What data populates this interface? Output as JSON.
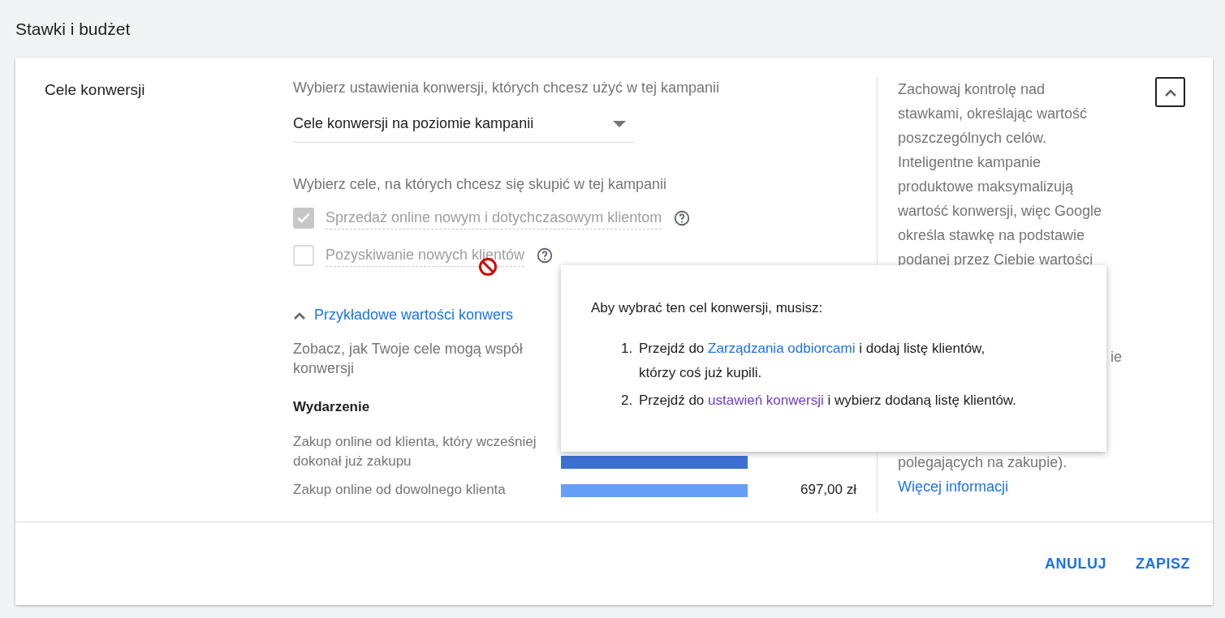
{
  "page_title": "Stawki i budżet",
  "section": {
    "label": "Cele konwersji",
    "settings_label": "Wybierz ustawienia konwersji, których chcesz użyć w tej kampanii",
    "dropdown": {
      "value": "Cele konwersji na poziomie kampanii"
    },
    "goals_label": "Wybierz cele, na których chcesz się skupić w tej kampanii",
    "goals": [
      {
        "label": "Sprzedaż online nowym i dotychczasowym klientom",
        "checked": true,
        "disabled": true
      },
      {
        "label": "Pozyskiwanie nowych klientów",
        "checked": false,
        "disabled": false
      }
    ],
    "examples": {
      "link": "Przykładowe wartości konwers",
      "expanded": true,
      "description": "Zobacz, jak Twoje cele mogą współ",
      "description_line_2": "konwersji",
      "column": "Wydarzenie",
      "rows": [
        {
          "event": "Zakup online od klienta, który wcześniej dokonał już zakupu",
          "color": "#3c6fd1"
        },
        {
          "event": "Zakup online od dowolnego klienta",
          "color": "#669df6",
          "value": "697,00 zł"
        }
      ]
    },
    "help": {
      "text": "Zachowaj kontrolę nad stawkami, określając wartość poszczególnych celów. Inteligentne kampanie produktowe maksymalizują wartość konwersji, więc Google określa stawkę na podstawie podanej przez Ciebie wartości",
      "fragment": "ie",
      "tail": "polegających na zakupie).",
      "link": "Więcej informacji"
    }
  },
  "tooltip": {
    "intro": "Aby wybrać ten cel konwersji, musisz:",
    "steps": [
      {
        "number": "1.",
        "before": "Przejdź do ",
        "link": "Zarządzania odbiorcami",
        "link_visited": false,
        "after": " i dodaj listę klientów, którzy coś już kupili."
      },
      {
        "number": "2.",
        "before": "Przejdź do ",
        "link": "ustawień konwersji",
        "link_visited": true,
        "after": " i wybierz dodaną listę klientów."
      }
    ]
  },
  "buttons": [
    "ANULUJ",
    "ZAPISZ"
  ]
}
